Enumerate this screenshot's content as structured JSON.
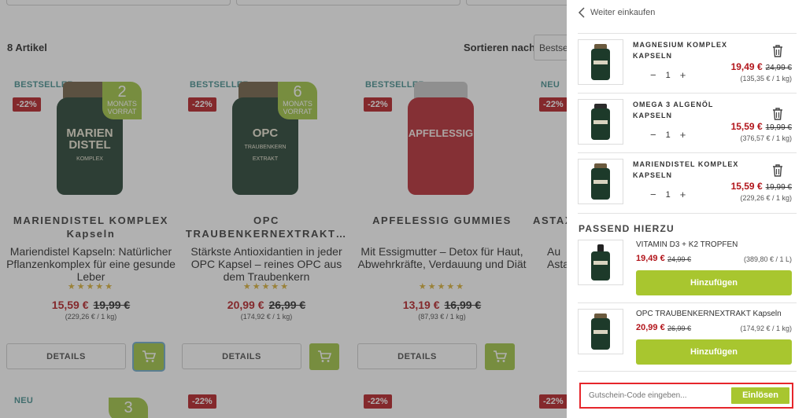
{
  "shop": {
    "article_count": "8 Artikel",
    "sort_label": "Sortieren nach:",
    "sort_value": "Bestsel",
    "products": [
      {
        "badge": "BESTSELLER",
        "discount": "-22%",
        "supply_num": "2",
        "supply_text": "MONATS VORRAT",
        "jar_label": "MARIEN DISTEL",
        "jar_sub": "KOMPLEX",
        "name_line1": "MARIENDISTEL KOMPLEX",
        "name_line2": "Kapseln",
        "desc": "Mariendistel Kapseln: Natürlicher Pflanzenkomplex für eine gesunde Leber",
        "stars": "★★★★★",
        "price": "15,59 €",
        "old_price": "19,99 €",
        "unit": "(229,26 € / 1 kg)",
        "details": "DETAILS"
      },
      {
        "badge": "BESTSELLER",
        "discount": "-22%",
        "supply_num": "6",
        "supply_text": "MONATS VORRAT",
        "jar_label": "OPC",
        "jar_sub": "TRAUBENKERN EXTRAKT",
        "name_line1": "OPC",
        "name_line2": "TRAUBENKERNEXTRAKT…",
        "desc": "Stärkste Antioxidantien in jeder OPC Kapsel – reines OPC aus dem Traubenkern",
        "stars": "★★★★★",
        "price": "20,99 €",
        "old_price": "26,99 €",
        "unit": "(174,92 € / 1 kg)",
        "details": "DETAILS"
      },
      {
        "badge": "BESTSELLER",
        "discount": "-22%",
        "jar_label": "APFELESSIG",
        "jar_sub": "",
        "name_line1": "APFELESSIG GUMMIES",
        "name_line2": "",
        "desc": "Mit Essigmutter – Detox für Haut, Abwehrkräfte, Verdauung und Diät",
        "stars": "★★★★★",
        "price": "13,19 €",
        "old_price": "16,99 €",
        "unit": "(87,93 € / 1 kg)",
        "details": "DETAILS"
      },
      {
        "badge": "NEU",
        "discount": "-22%",
        "name_line1": "ASTAX",
        "desc": "Au\nAsta"
      }
    ],
    "row2": [
      {
        "badge": "NEU",
        "supply_num": "3"
      },
      {
        "discount": "-22%"
      },
      {
        "discount": "-22%"
      },
      {
        "discount": "-22%"
      }
    ]
  },
  "drawer": {
    "back_label": "Weiter einkaufen",
    "items": [
      {
        "name": "MAGNESIUM KOMPLEX KAPSELN",
        "qty": "1",
        "price": "19,49 €",
        "old_price": "24,99 €",
        "unit": "(135,35 € / 1 kg)"
      },
      {
        "name": "OMEGA 3 ALGENÖL KAPSELN",
        "qty": "1",
        "price": "15,59 €",
        "old_price": "19,99 €",
        "unit": "(376,57 € / 1 kg)"
      },
      {
        "name": "MARIENDISTEL KOMPLEX KAPSELN",
        "qty": "1",
        "price": "15,59 €",
        "old_price": "19,99 €",
        "unit": "(229,26 € / 1 kg)"
      }
    ],
    "qty_minus": "−",
    "qty_plus": "+",
    "suggestions_title": "PASSEND HIERZU",
    "suggestions": [
      {
        "name": "VITAMIN D3 + K2 TROPFEN",
        "price": "19,49 €",
        "old_price": "24,99 €",
        "unit": "(389,80 € / 1 L)",
        "button": "Hinzufügen"
      },
      {
        "name": "OPC TRAUBENKERNEXTRAKT Kapseln",
        "price": "20,99 €",
        "old_price": "26,99 €",
        "unit": "(174,92 € / 1 kg)",
        "button": "Hinzufügen"
      }
    ],
    "coupon": {
      "placeholder": "Gutschein-Code eingeben...",
      "button": "Einlösen"
    }
  },
  "colors": {
    "accent_green": "#a8c62f",
    "price_red": "#b2151b",
    "highlight_red": "#e6262b"
  }
}
